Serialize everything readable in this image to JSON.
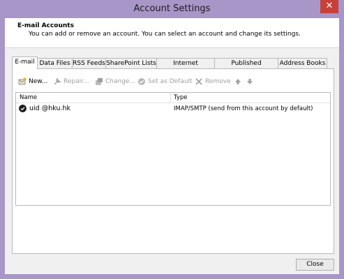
{
  "window": {
    "title": "Account Settings",
    "close_glyph": "✕"
  },
  "header": {
    "title": "E-mail Accounts",
    "subtitle": "You can add or remove an account. You can select an account and change its settings."
  },
  "tabs": [
    {
      "label": "E-mail",
      "active": true
    },
    {
      "label": "Data Files"
    },
    {
      "label": "RSS Feeds"
    },
    {
      "label": "SharePoint Lists"
    },
    {
      "label": "Internet Calendars"
    },
    {
      "label": "Published Calendars"
    },
    {
      "label": "Address Books"
    }
  ],
  "toolbar": {
    "new_label": "New...",
    "repair_label": "Repair...",
    "change_label": "Change...",
    "set_default_label": "Set as Default",
    "remove_label": "Remove",
    "icons": [
      "new-account-icon",
      "wrench-icon",
      "change-icon",
      "check-circle-icon",
      "remove-x-icon",
      "up-arrow-icon",
      "down-arrow-icon"
    ]
  },
  "accounts_list": {
    "columns": [
      "Name",
      "Type"
    ],
    "rows": [
      {
        "name": "uid @hku.hk",
        "type": "IMAP/SMTP (send from this account by default)",
        "default": true
      }
    ]
  },
  "footer": {
    "close_label": "Close"
  },
  "colors": {
    "title_bar": "#a896c8",
    "close_button": "#c7403a",
    "panel": "#ffffff",
    "dialog_bg": "#f0f0f0"
  }
}
